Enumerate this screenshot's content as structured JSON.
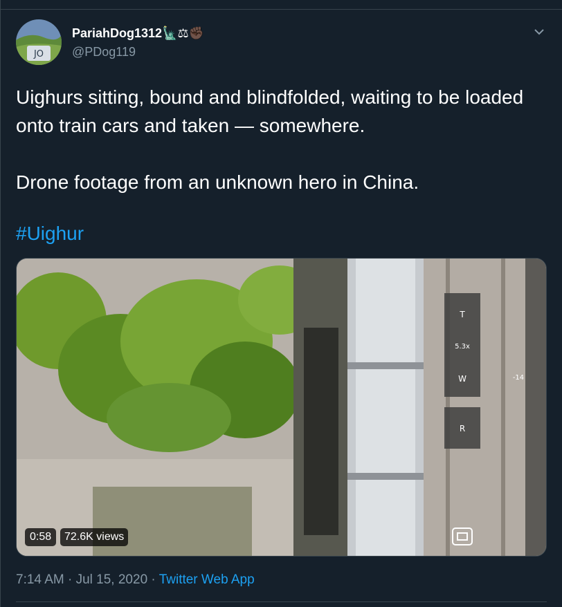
{
  "user": {
    "display_name": "PariahDog1312🗽⚖✊🏿",
    "handle": "@PDog119",
    "avatar_text": "JO"
  },
  "tweet": {
    "line1": "Uighurs sitting, bound and blindfolded, waiting to be loaded onto train cars and taken — somewhere.",
    "line2": "Drone footage from an unknown hero in China.",
    "hashtag": "#Uighur"
  },
  "media": {
    "duration": "0:58",
    "views": "72.6K views",
    "hud_top": "T",
    "hud_zoom": "5.3x",
    "hud_wide": "W",
    "hud_r": "R",
    "hud_side": "-14"
  },
  "footer": {
    "time": "7:14 AM",
    "separator1": " · ",
    "date": "Jul 15, 2020",
    "separator2": " · ",
    "source": "Twitter Web App"
  },
  "colors": {
    "background": "#15202b",
    "link": "#1da1f2",
    "secondary_text": "#8899a6",
    "divider": "#38444d"
  }
}
